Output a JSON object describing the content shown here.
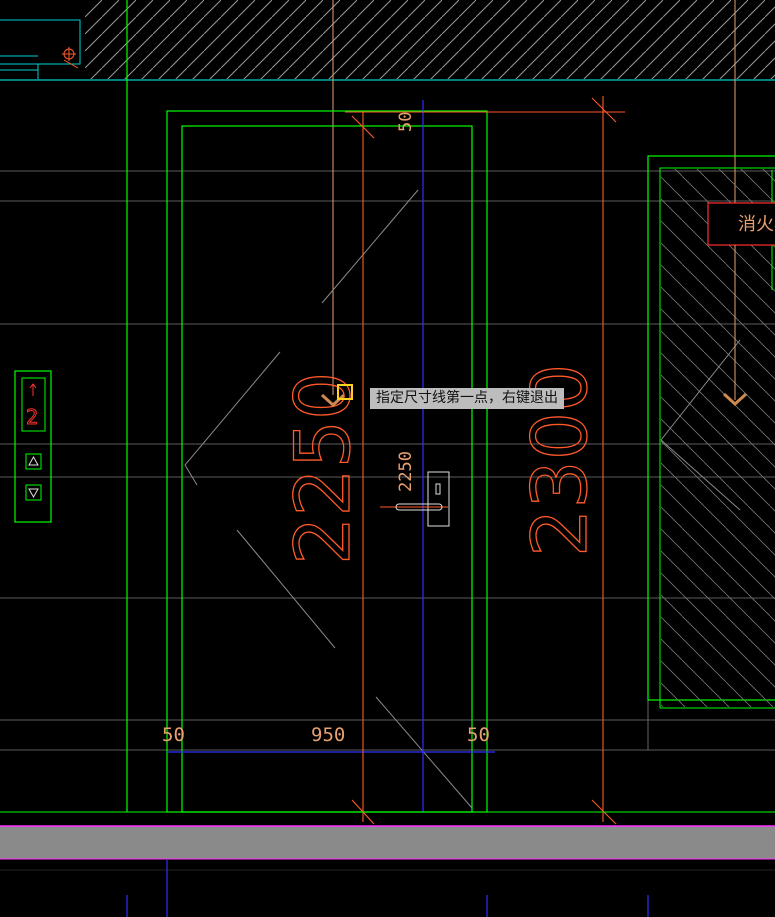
{
  "tooltip": {
    "text": "指定尺寸线第一点，右键退出"
  },
  "dimensions": {
    "top_gap": "50",
    "door_height": "2250",
    "opening_height": "2300",
    "handle_height": "2250",
    "left_frame": "50",
    "door_width": "950",
    "right_frame": "50"
  },
  "panel": {
    "label": "消火栓"
  },
  "elevator_panel": {
    "floor": "2"
  },
  "colors": {
    "background": "#000000",
    "green": "#00ff00",
    "orange": "#ff5a2a",
    "blue": "#3030ff",
    "cyan": "#00d0d0",
    "gray_band": "#8a8a8a",
    "tooltip_bg": "#bdbdbd",
    "marker_yellow": "#ffd21f"
  }
}
